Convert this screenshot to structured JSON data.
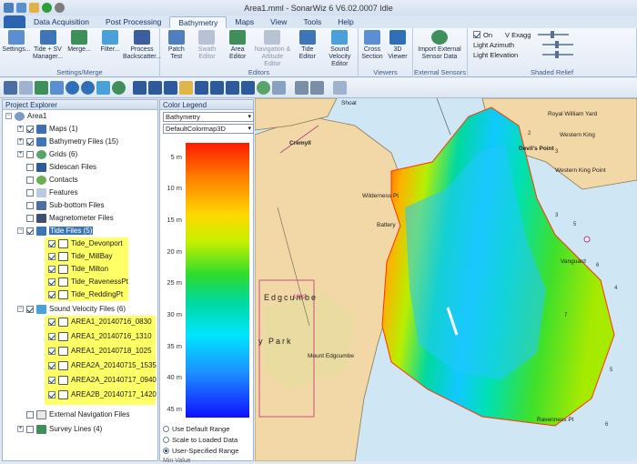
{
  "window": {
    "title": "Area1.mml - SonarWiz 6 V6.02.0007 Idle"
  },
  "tabs": [
    "Data Acquisition",
    "Post Processing",
    "Bathymetry",
    "Maps",
    "View",
    "Tools",
    "Help"
  ],
  "ribbon": {
    "groups": [
      {
        "label": "Settings/Merge",
        "buttons": [
          "Settings...",
          "Tide + SV Manager...",
          "Merge...",
          "Filter...",
          "Process Backscatter..."
        ]
      },
      {
        "label": "Editors",
        "buttons": [
          "Patch Test",
          "Swath Editor",
          "Area Editor",
          "Navigation & Attitude Editor",
          "Tide Editor",
          "Sound Velocity Editor"
        ]
      },
      {
        "label": "Viewers",
        "buttons": [
          "Cross Section",
          "3D Viewer"
        ]
      },
      {
        "label": "External Sensors",
        "buttons": [
          "Import External Sensor Data"
        ]
      },
      {
        "label": "Shaded Relief",
        "items": [
          "On",
          "V Exagg",
          "Light Azimuth",
          "Light Elevation"
        ]
      }
    ]
  },
  "project_explorer": {
    "title": "Project Explorer",
    "root": "Area1",
    "items": [
      {
        "label": "Maps (1)"
      },
      {
        "label": "Bathymetry Files (15)"
      },
      {
        "label": "Grids (6)"
      },
      {
        "label": "Sidescan Files"
      },
      {
        "label": "Contacts"
      },
      {
        "label": "Features"
      },
      {
        "label": "Sub-bottom Files"
      },
      {
        "label": "Magnetometer Files"
      },
      {
        "label": "Tide Files (5)"
      },
      {
        "label": "Tide_Devonport"
      },
      {
        "label": "Tide_MillBay"
      },
      {
        "label": "Tide_Milton"
      },
      {
        "label": "Tide_RavenessPt"
      },
      {
        "label": "Tide_ReddingPt"
      },
      {
        "label": "Sound Velocity Files (6)"
      },
      {
        "label": "AREA1_20140716_0830"
      },
      {
        "label": "AREA1_20140716_1310"
      },
      {
        "label": "AREA1_20140718_1025"
      },
      {
        "label": "AREA2A_20140715_1535"
      },
      {
        "label": "AREA2A_20140717_0940"
      },
      {
        "label": "AREA2B_20140717_1420"
      },
      {
        "label": "External Navigation Files"
      },
      {
        "label": "Survey Lines (4)"
      }
    ]
  },
  "color_legend": {
    "title": "Color Legend",
    "layer": "Bathymetry",
    "colormap": "DefaultColormap3D",
    "ticks": [
      "5 m",
      "10 m",
      "15 m",
      "20 m",
      "25 m",
      "30 m",
      "35 m",
      "40 m",
      "45 m"
    ],
    "options": [
      "Use Default Range",
      "Scale to Loaded Data",
      "User-Specified Range"
    ],
    "selected_option": "User-Specified Range",
    "min_label": "Min Value"
  },
  "map_labels": [
    "Shoal",
    "Cremyll",
    "Royal William Yard",
    "Western King",
    "Devil's Point",
    "Western King Point",
    "Wilderness Pt",
    "Battery",
    "Vanguard",
    "Edgcumbe",
    "y Park",
    "Mount Edgcumbe",
    "Ravenness Pt",
    "1902"
  ],
  "colors": {
    "accent": "#2b65b1",
    "highlight": "#ffff66",
    "land": "#f2d8a7",
    "water": "#cfe6f5"
  }
}
